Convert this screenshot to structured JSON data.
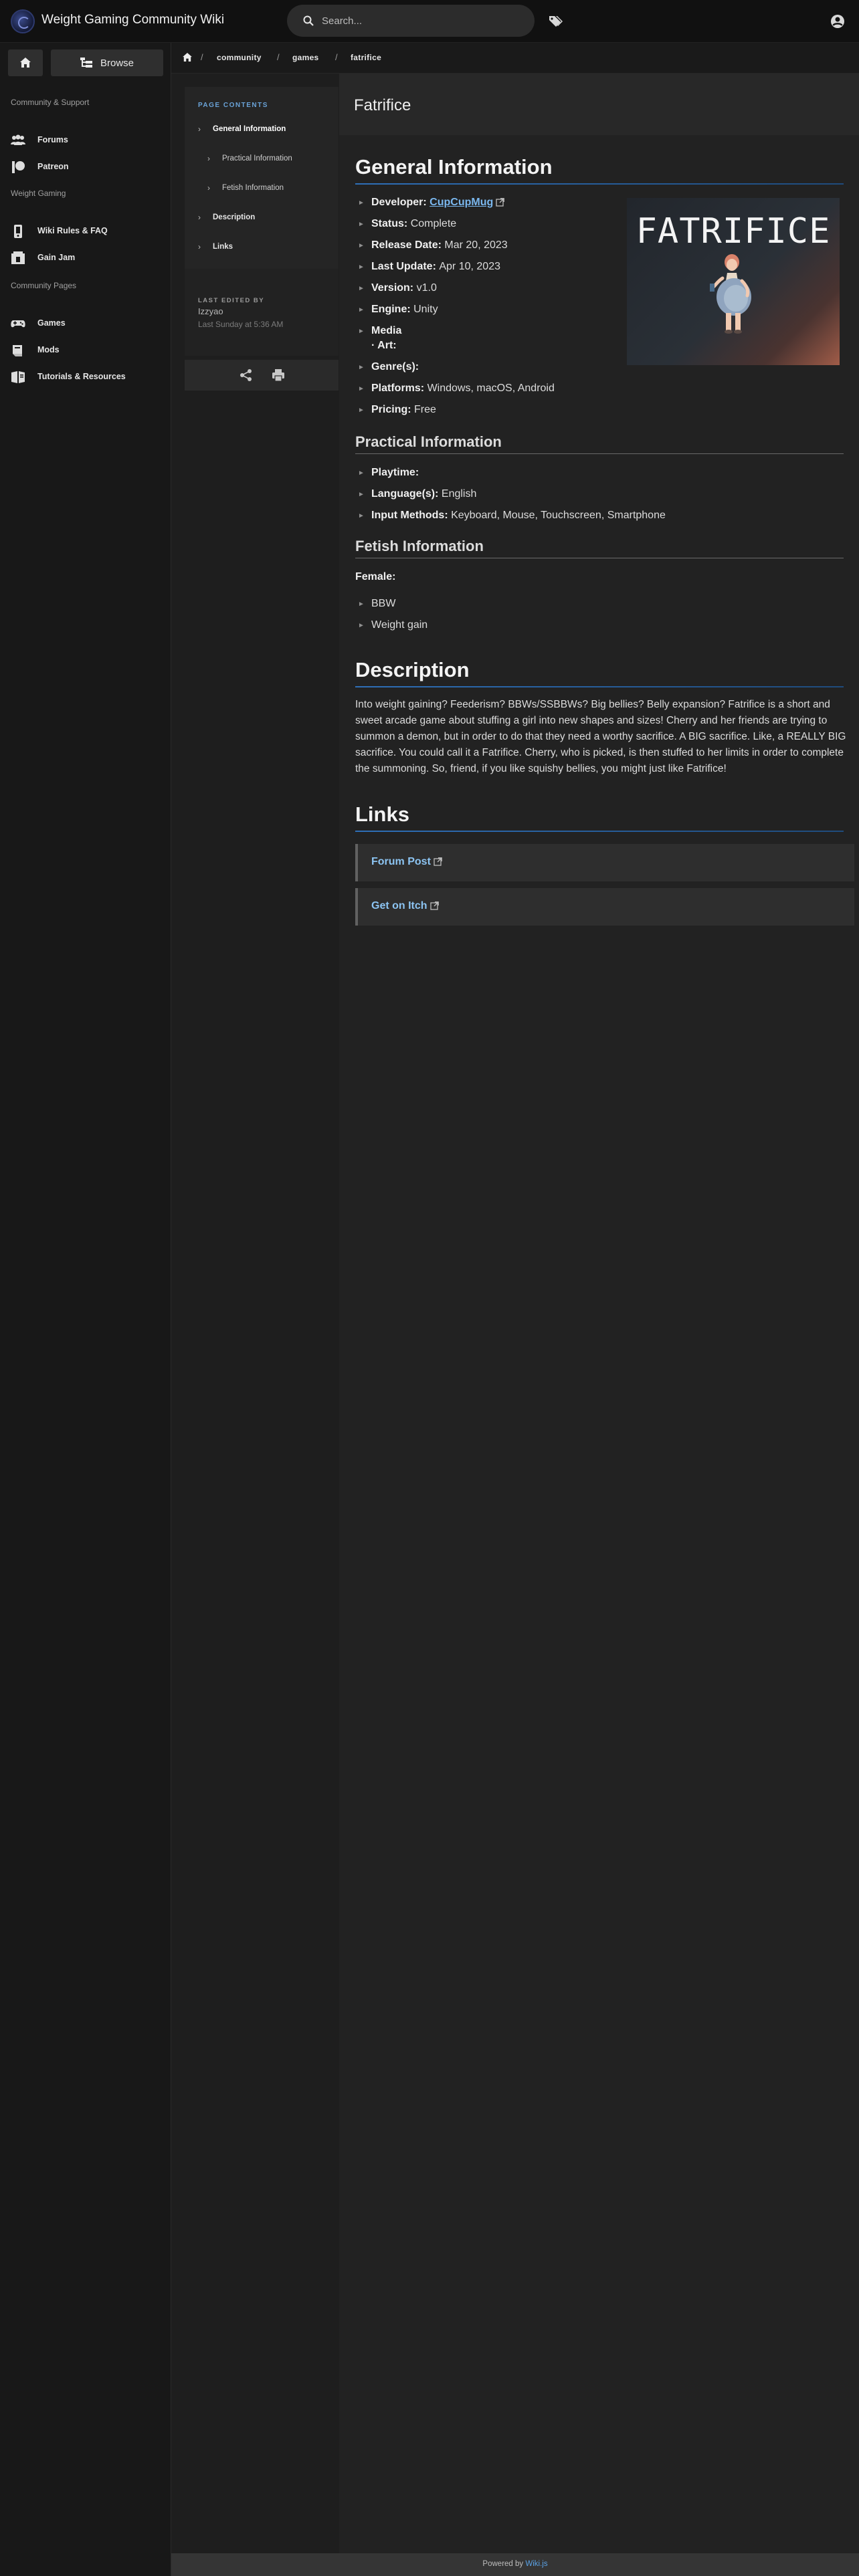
{
  "header": {
    "site_title": "Weight Gaming Community Wiki",
    "search_placeholder": "Search..."
  },
  "sidebar": {
    "browse_label": "Browse",
    "sections": [
      {
        "header": "Community & Support"
      },
      {
        "header": "Weight Gaming"
      },
      {
        "header": "Community Pages"
      }
    ],
    "items": [
      {
        "label": "Forums",
        "icon": "forums-icon"
      },
      {
        "label": "Patreon",
        "icon": "patreon-icon"
      },
      {
        "label": "Wiki Rules & FAQ",
        "icon": "wiki-rules-icon"
      },
      {
        "label": "Gain Jam",
        "icon": "gain-jam-icon"
      },
      {
        "label": "Games",
        "icon": "gamepad-icon"
      },
      {
        "label": "Mods",
        "icon": "mods-icon"
      },
      {
        "label": "Tutorials & Resources",
        "icon": "tutorials-icon"
      }
    ]
  },
  "breadcrumb": [
    "community",
    "games",
    "fatrifice"
  ],
  "toc": {
    "title": "PAGE CONTENTS",
    "items": [
      "General Information",
      "Practical Information",
      "Fetish Information",
      "Description",
      "Links"
    ]
  },
  "edited": {
    "label": "LAST EDITED BY",
    "user": "Izzyao",
    "time": "Last Sunday at 5:36 AM"
  },
  "page": {
    "title": "Fatrifice",
    "general": {
      "heading": "General Information",
      "developer_label": "Developer:",
      "developer": "CupCupMug",
      "status_label": "Status:",
      "status": "Complete",
      "release_label": "Release Date:",
      "release": "Mar 20, 2023",
      "update_label": "Last Update:",
      "update": "Apr 10, 2023",
      "version_label": "Version:",
      "version": "v1.0",
      "engine_label": "Engine:",
      "engine": "Unity",
      "media_label": "Media",
      "art_label": "· Art:",
      "genre_label": "Genre(s):",
      "platforms_label": "Platforms:",
      "platforms": "Windows, macOS, Android",
      "pricing_label": "Pricing:",
      "pricing": "Free"
    },
    "practical": {
      "heading": "Practical Information",
      "playtime_label": "Playtime:",
      "language_label": "Language(s):",
      "language": "English",
      "input_label": "Input Methods:",
      "input": "Keyboard, Mouse, Touchscreen, Smartphone"
    },
    "fetish": {
      "heading": "Fetish Information",
      "female_label": "Female:",
      "female_items": [
        "BBW",
        "Weight gain"
      ]
    },
    "description": {
      "heading": "Description",
      "text": "Into weight gaining? Feederism? BBWs/SSBBWs? Big bellies? Belly expansion? Fatrifice is a short and sweet arcade game about stuffing a girl into new shapes and sizes! Cherry and her friends are trying to summon a demon, but in order to do that they need a worthy sacrifice. A BIG sacrifice. Like, a REALLY BIG sacrifice. You could call it a Fatrifice. Cherry, who is picked, is then stuffed to her limits in order to complete the summoning. So, friend, if you like squishy bellies, you might just like Fatrifice!"
    },
    "links": {
      "heading": "Links",
      "items": [
        "Forum Post",
        "Get on Itch"
      ]
    },
    "cover_title": "FATRIFICE"
  },
  "footer": {
    "prefix": "Powered by",
    "brand": "Wiki.js"
  }
}
